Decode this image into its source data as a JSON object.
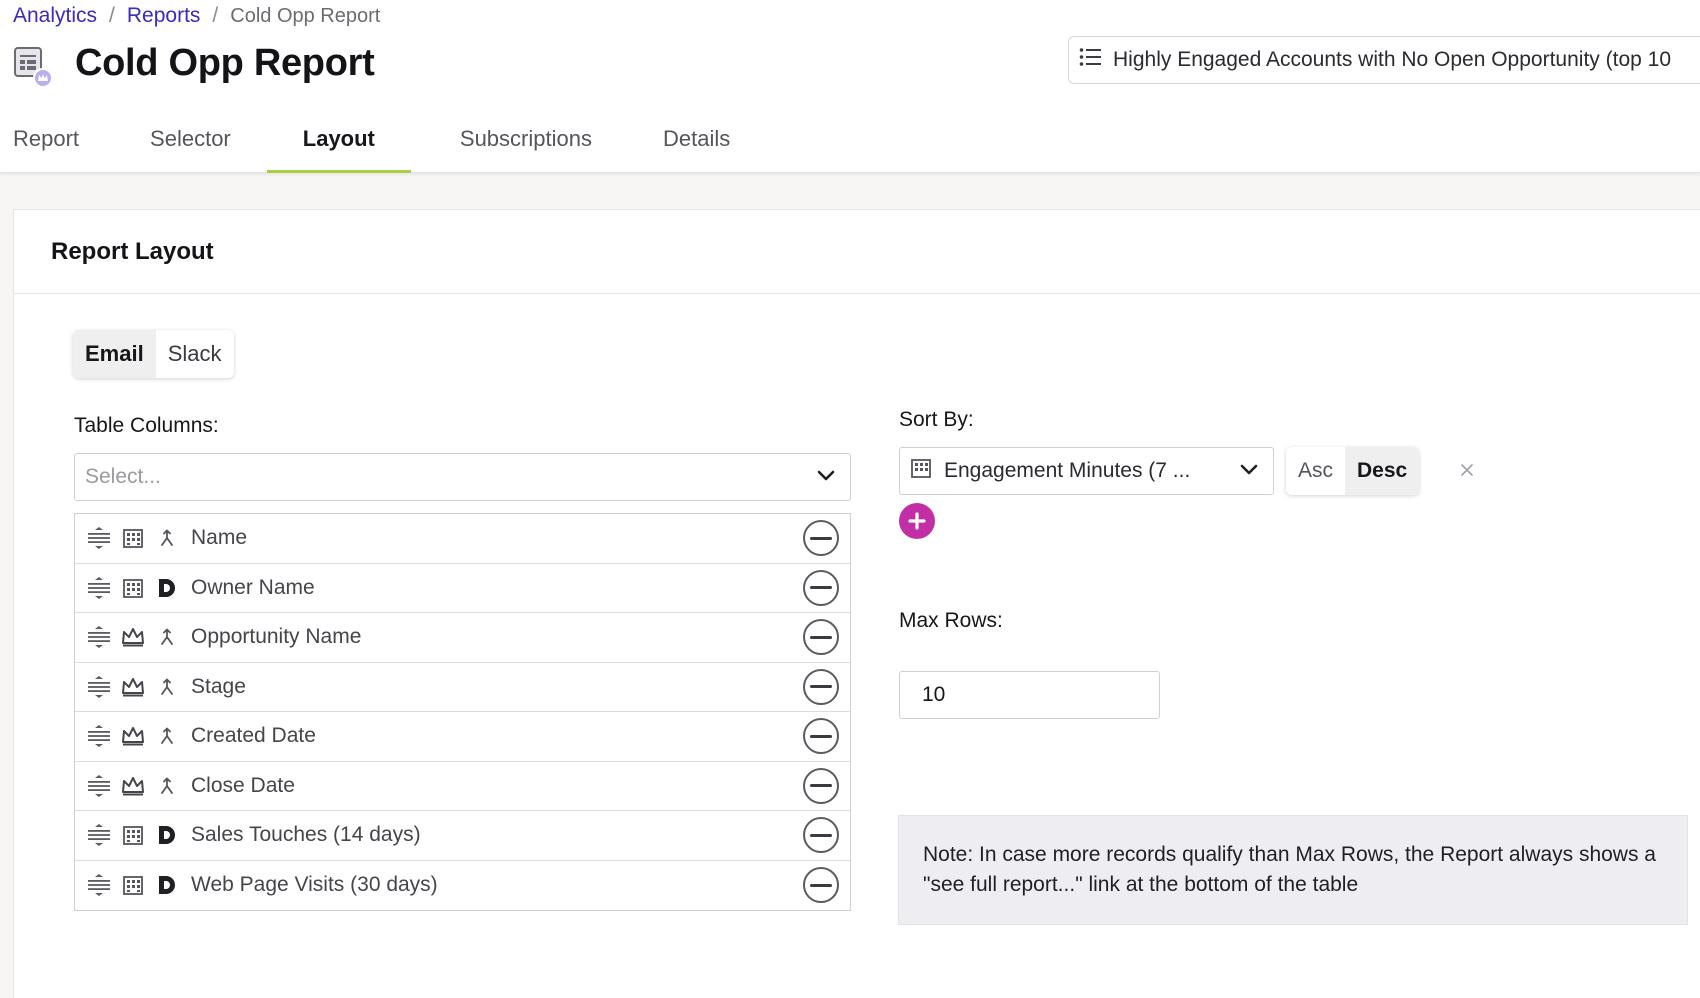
{
  "breadcrumb": {
    "items": [
      "Analytics",
      "Reports"
    ],
    "separator": "/",
    "current": "Cold Opp Report"
  },
  "page": {
    "title": "Cold Opp Report",
    "selector_label": "Highly Engaged Accounts with No Open Opportunity (top 10"
  },
  "tabs": [
    {
      "label": "Report",
      "active": false
    },
    {
      "label": "Selector",
      "active": false
    },
    {
      "label": "Layout",
      "active": true
    },
    {
      "label": "Subscriptions",
      "active": false
    },
    {
      "label": "Details",
      "active": false
    }
  ],
  "layout": {
    "section_title": "Report Layout",
    "channels": [
      {
        "label": "Email",
        "active": true
      },
      {
        "label": "Slack",
        "active": false
      }
    ],
    "table_columns_label": "Table Columns:",
    "select_placeholder": "Select...",
    "columns": [
      {
        "name": "Name",
        "object_icon": "building-icon",
        "source_icon": "merge-icon"
      },
      {
        "name": "Owner Name",
        "object_icon": "building-icon",
        "source_icon": "d-logo-icon"
      },
      {
        "name": "Opportunity Name",
        "object_icon": "crown-icon",
        "source_icon": "merge-icon"
      },
      {
        "name": "Stage",
        "object_icon": "crown-icon",
        "source_icon": "merge-icon"
      },
      {
        "name": "Created Date",
        "object_icon": "crown-icon",
        "source_icon": "merge-icon"
      },
      {
        "name": "Close Date",
        "object_icon": "crown-icon",
        "source_icon": "merge-icon"
      },
      {
        "name": "Sales Touches (14 days)",
        "object_icon": "building-icon",
        "source_icon": "d-logo-icon"
      },
      {
        "name": "Web Page Visits (30 days)",
        "object_icon": "building-icon",
        "source_icon": "d-logo-icon"
      }
    ],
    "sort_by_label": "Sort By:",
    "sort_by_value": "Engagement Minutes (7 ...",
    "sort_direction": [
      {
        "label": "Asc",
        "active": false
      },
      {
        "label": "Desc",
        "active": true
      }
    ],
    "max_rows_label": "Max Rows:",
    "max_rows_value": "10",
    "note": "Note: In case more records qualify than Max Rows, the Report always shows a \"see full report...\" link at the bottom of the table"
  },
  "colors": {
    "link": "#3b2bb8",
    "tab_active_underline": "#a8cf45",
    "add_button": "#c22ea6",
    "note_bg": "#eeeef2"
  }
}
